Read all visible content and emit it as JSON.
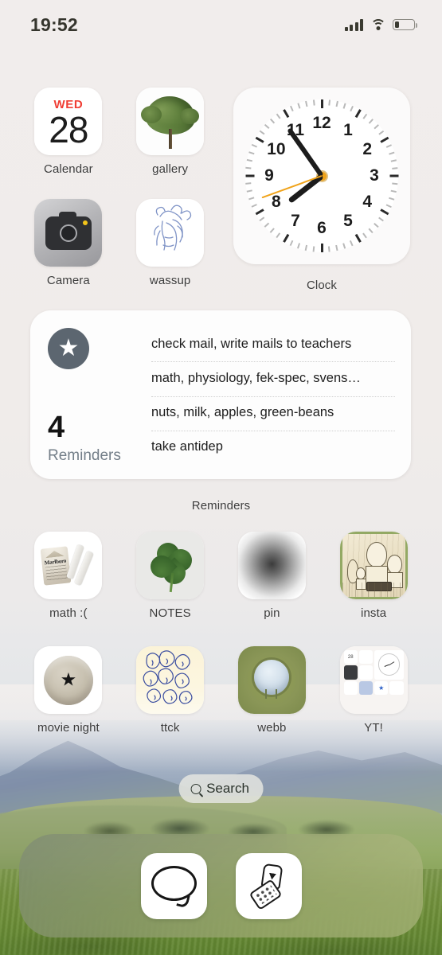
{
  "status_bar": {
    "time": "19:52",
    "signal_icon": "cellular-signal-icon",
    "wifi_icon": "wifi-icon",
    "battery_icon": "battery-icon",
    "battery_level_percent": 25
  },
  "calendar_widget": {
    "weekday": "WED",
    "day": "28",
    "label": "Calendar"
  },
  "clock_widget": {
    "label": "Clock",
    "numbers": [
      "12",
      "1",
      "2",
      "3",
      "4",
      "5",
      "6",
      "7",
      "8",
      "9",
      "10",
      "11"
    ],
    "hour_deg": 232,
    "minute_deg": 325,
    "second_deg": 250
  },
  "reminders_widget": {
    "count": "4",
    "title": "Reminders",
    "widget_label": "Reminders",
    "star_icon": "star-circle-icon",
    "items": [
      "check mail, write mails to teachers",
      "math, physiology, fek-spec, svens…",
      "nuts, milk, apples, green-beans",
      "take antidep"
    ]
  },
  "app_rows": [
    [
      {
        "label": "Calendar",
        "icon": "calendar-icon"
      },
      {
        "label": "gallery",
        "icon": "tree-photo-icon"
      }
    ],
    [
      {
        "label": "Camera",
        "icon": "camera-icon"
      },
      {
        "label": "wassup",
        "icon": "blue-sketch-icon"
      }
    ],
    [
      {
        "label": "math :(",
        "icon": "cigarette-pack-icon"
      },
      {
        "label": "NOTES",
        "icon": "four-leaf-clover-icon"
      },
      {
        "label": "pin",
        "icon": "blurred-gradient-icon"
      },
      {
        "label": "insta",
        "icon": "doodle-drawing-icon"
      }
    ],
    [
      {
        "label": "movie night",
        "icon": "bowl-star-icon"
      },
      {
        "label": "ttck",
        "icon": "blue-faces-icon"
      },
      {
        "label": "webb",
        "icon": "olive-circle-icon"
      },
      {
        "label": "YT!",
        "icon": "folder-preview-icon"
      }
    ]
  ],
  "search": {
    "label": "Search",
    "icon": "search-icon"
  },
  "dock": {
    "items": [
      {
        "name": "messages",
        "icon": "speech-bubble-icon"
      },
      {
        "name": "phone",
        "icon": "flip-phone-icon"
      }
    ]
  },
  "colors": {
    "background": "#f1eeed",
    "label_text": "#3c3c3c",
    "calendar_red": "#f03e34",
    "reminders_title": "#737e88",
    "clock_second_hand": "#f0a31a",
    "status_icons": "#3a3a30"
  }
}
